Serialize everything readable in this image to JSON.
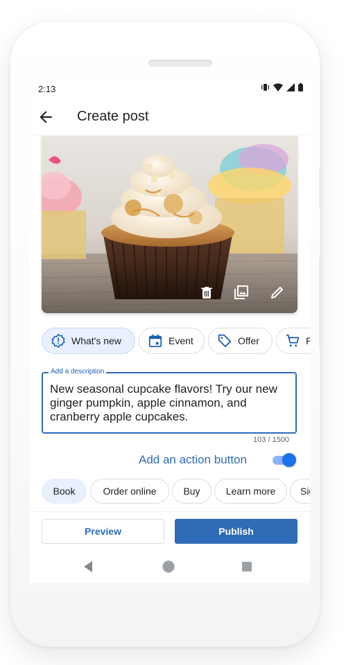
{
  "status_bar": {
    "time": "2:13"
  },
  "app_bar": {
    "title": "Create post"
  },
  "photo": {
    "icons": [
      "delete-icon",
      "photo-library-icon",
      "edit-icon"
    ]
  },
  "post_types": [
    {
      "label": "What's new",
      "icon": "whats-new-badge-icon",
      "selected": true
    },
    {
      "label": "Event",
      "icon": "calendar-event-icon",
      "selected": false
    },
    {
      "label": "Offer",
      "icon": "tag-icon",
      "selected": false
    },
    {
      "label": "P",
      "icon": "cart-icon",
      "selected": false
    }
  ],
  "description": {
    "label": "Add a description",
    "value": "New seasonal cupcake flavors! Try our new ginger pumpkin, apple cinnamon, and cranberry apple cupcakes.",
    "counter": "103 / 1500"
  },
  "action_button": {
    "label": "Add an action button",
    "enabled": true
  },
  "action_types": [
    {
      "label": "Book",
      "selected": true
    },
    {
      "label": "Order online",
      "selected": false
    },
    {
      "label": "Buy",
      "selected": false
    },
    {
      "label": "Learn more",
      "selected": false
    },
    {
      "label": "Sig",
      "selected": false
    }
  ],
  "buttons": {
    "preview": "Preview",
    "publish": "Publish"
  },
  "colors": {
    "accent": "#2f6bb6",
    "chip_selected": "#e8f0fe",
    "toggle": "#1a73e8"
  }
}
